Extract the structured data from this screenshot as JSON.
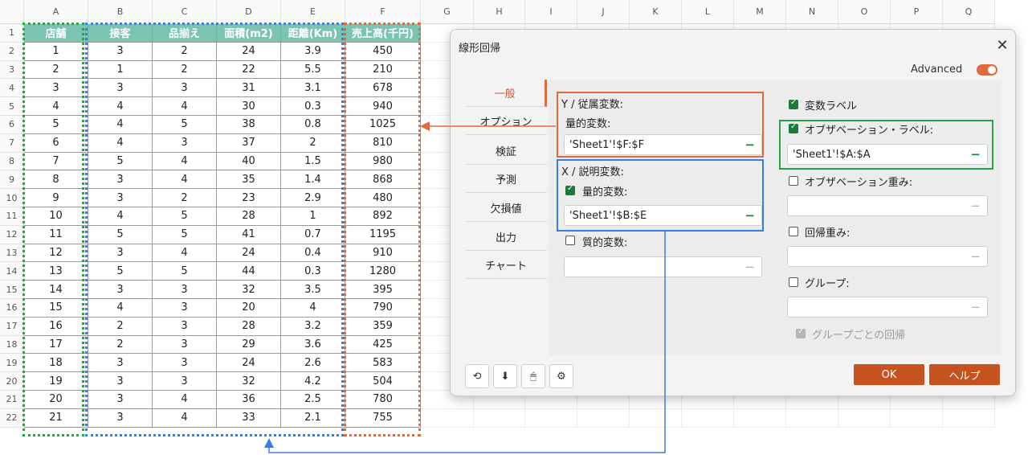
{
  "sheet": {
    "columns": [
      "A",
      "B",
      "C",
      "D",
      "E",
      "F",
      "G",
      "H",
      "I",
      "J",
      "K",
      "L",
      "M",
      "N",
      "O",
      "P",
      "Q"
    ],
    "rows": [
      "1",
      "2",
      "3",
      "4",
      "5",
      "6",
      "7",
      "8",
      "9",
      "10",
      "11",
      "12",
      "13",
      "14",
      "15",
      "16",
      "17",
      "18",
      "19",
      "20",
      "21",
      "22"
    ],
    "headers": [
      "店舗",
      "接客",
      "品揃え",
      "面積(m2)",
      "距離(Km)",
      "売上高(千円)"
    ],
    "data": [
      [
        "1",
        "3",
        "2",
        "24",
        "3.9",
        "450"
      ],
      [
        "2",
        "1",
        "2",
        "22",
        "5.5",
        "210"
      ],
      [
        "3",
        "3",
        "3",
        "31",
        "3.1",
        "678"
      ],
      [
        "4",
        "4",
        "4",
        "30",
        "0.3",
        "940"
      ],
      [
        "5",
        "4",
        "5",
        "38",
        "0.8",
        "1025"
      ],
      [
        "6",
        "4",
        "3",
        "37",
        "2",
        "810"
      ],
      [
        "7",
        "5",
        "4",
        "40",
        "1.5",
        "980"
      ],
      [
        "8",
        "3",
        "4",
        "35",
        "1.4",
        "868"
      ],
      [
        "9",
        "3",
        "2",
        "23",
        "2.9",
        "480"
      ],
      [
        "10",
        "4",
        "5",
        "28",
        "1",
        "892"
      ],
      [
        "11",
        "5",
        "5",
        "41",
        "0.7",
        "1195"
      ],
      [
        "12",
        "3",
        "4",
        "24",
        "0.4",
        "910"
      ],
      [
        "13",
        "5",
        "5",
        "44",
        "0.3",
        "1280"
      ],
      [
        "14",
        "3",
        "3",
        "32",
        "3.5",
        "395"
      ],
      [
        "15",
        "4",
        "3",
        "20",
        "4",
        "790"
      ],
      [
        "16",
        "2",
        "3",
        "28",
        "3.2",
        "359"
      ],
      [
        "17",
        "2",
        "3",
        "29",
        "3.6",
        "425"
      ],
      [
        "18",
        "3",
        "3",
        "24",
        "2.6",
        "583"
      ],
      [
        "19",
        "3",
        "3",
        "32",
        "4.2",
        "504"
      ],
      [
        "20",
        "3",
        "4",
        "36",
        "2.5",
        "780"
      ],
      [
        "21",
        "3",
        "4",
        "33",
        "2.1",
        "755"
      ]
    ]
  },
  "dialog": {
    "title": "線形回帰",
    "close": "✕",
    "advanced_label": "Advanced",
    "advanced_on": true,
    "tabs": [
      "一般",
      "オプション",
      "検証",
      "予測",
      "欠損値",
      "出力",
      "チャート"
    ],
    "active_tab": "一般",
    "y_section": {
      "title": "Y / 従属変数:",
      "quant_label": "量的変数:",
      "quant_value": "'Sheet1'!$F:$F"
    },
    "x_section": {
      "title": "X / 説明変数:",
      "quant_label": "量的変数:",
      "quant_value": "'Sheet1'!$B:$E",
      "qual_label": "質的変数:",
      "qual_value": ""
    },
    "right": {
      "var_labels": "変数ラベル",
      "obs_labels": "オブザベーション・ラベル:",
      "obs_labels_value": "'Sheet1'!$A:$A",
      "obs_weights": "オブザベーション重み:",
      "reg_weights": "回帰重み:",
      "group": "グループ:",
      "group_reg": "グループごとの回帰"
    },
    "buttons": {
      "reset_icon": "⟲",
      "download_icon": "⬇",
      "mouse_icon": "🖱",
      "settings_icon": "⚙",
      "ok": "OK",
      "help": "ヘルプ"
    },
    "minus": "−"
  },
  "colors": {
    "header_fill": "#7bc4b2",
    "green_box": "#2aa344",
    "blue_box": "#3a7de0",
    "orange_box": "#e06a3a",
    "accent": "#c6531f"
  }
}
